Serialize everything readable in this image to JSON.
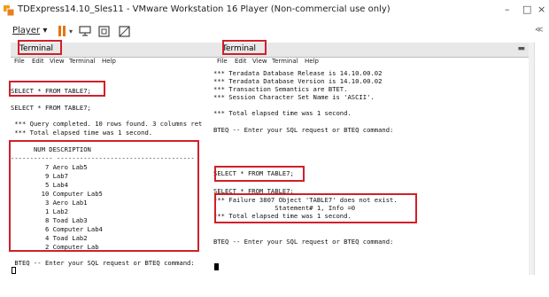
{
  "window": {
    "title": "TDExpress14.10_Sles11 - VMware Workstation 16 Player (Non-commercial use only)",
    "minimize": "–",
    "maximize": "□",
    "close": "×"
  },
  "toolbar": {
    "player_label": "Player",
    "collapse_label": "≪"
  },
  "left": {
    "tab": "Terminal",
    "menu": [
      "File",
      "Edit",
      "View",
      "Terminal",
      "Help"
    ],
    "lines": [
      "SELECT * FROM TABLE7;",
      "SELECT * FROM TABLE7;",
      " *** Query completed. 10 rows found. 3 columns ret",
      " *** Total elapsed time was 1 second.",
      "      NUM DESCRIPTION",
      "----------- ------------------------------------",
      "         7 Aero Lab5",
      "         9 Lab7",
      "         5 Lab4",
      "        10 Computer Lab5",
      "         3 Aero Lab1",
      "         1 Lab2",
      "         8 Toad Lab3",
      "         6 Computer Lab4",
      "         4 Toad Lab2",
      "         2 Computer Lab",
      " BTEQ -- Enter your SQL request or BTEQ command:"
    ]
  },
  "right": {
    "tab": "Terminal",
    "menu": [
      "File",
      "Edit",
      "View",
      "Terminal",
      "Help"
    ],
    "lines": [
      "*** Teradata Database Release is 14.10.00.02",
      "*** Teradata Database Version is 14.10.00.02",
      "*** Transaction Semantics are BTET.",
      "*** Session Character Set Name is 'ASCII'.",
      "*** Total elapsed time was 1 second.",
      "BTEQ -- Enter your SQL request or BTEQ command:",
      "SELECT * FROM TABLE7;",
      "SELECT * FROM TABLE7;",
      "*** Failure 3807 Object 'TABLE7' does not exist.",
      "                Statement# 1, Info =0",
      "*** Total elapsed time was 1 second.",
      "BTEQ -- Enter your SQL request or BTEQ command:"
    ]
  },
  "colors": {
    "highlight": "#d0202a",
    "pause": "#e8730c"
  }
}
